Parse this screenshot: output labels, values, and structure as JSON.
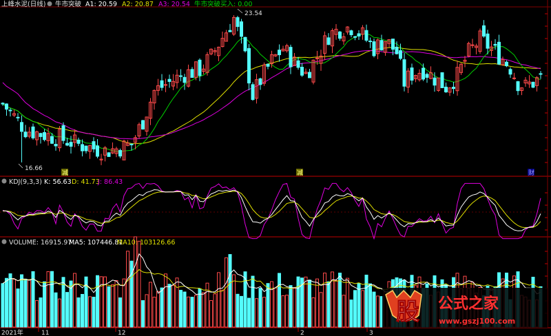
{
  "header": {
    "stock_name": "上峰水泥(日线)",
    "indicator_name": "牛市突破",
    "a1_label": "A1: 20.59",
    "a2_label": "A2: 20.87",
    "a3_label": "A3: 20.54",
    "signal_label": "牛市突破买入: 0.00"
  },
  "kdj": {
    "title": "KDJ(9,3,3)",
    "k_label": "K: 56.63",
    "d_label": "D: 41.73",
    "j_label": "J: 86.43"
  },
  "volume": {
    "title": "VOLUME: 16915.97",
    "ma5_label": "MA5: 107446.81",
    "ma10_label": "MA10: 103126.66"
  },
  "markers": {
    "high": "23.54",
    "low": "16.66",
    "badge1": "减",
    "badge2": "减",
    "badge3": "财"
  },
  "xaxis": {
    "year": "2021年",
    "m11": "11",
    "m12": "12",
    "m2": "2",
    "m3": "3"
  },
  "watermark": {
    "glyph": "股",
    "name": "公式之家",
    "url": "www.gszj100.com"
  },
  "colors": {
    "up": "#ff4a4a",
    "down": "#54fcfc",
    "ma_fast": "#ffffff",
    "ma_green": "#00d000",
    "ma_yellow": "#e0e000",
    "ma_purple": "#e000e0"
  },
  "chart_data": {
    "type": "candlestick",
    "series": [
      {
        "name": "A1",
        "value": 20.59
      },
      {
        "name": "A2",
        "value": 20.87
      },
      {
        "name": "A3",
        "value": 20.54
      },
      {
        "name": "K",
        "value": 56.63
      },
      {
        "name": "D",
        "value": 41.73
      },
      {
        "name": "J",
        "value": 86.43
      },
      {
        "name": "VOLUME",
        "value": 16915.97
      },
      {
        "name": "MA5",
        "value": 107446.81
      },
      {
        "name": "MA10",
        "value": 103126.66
      }
    ],
    "price_high": 23.54,
    "price_low": 16.66
  }
}
